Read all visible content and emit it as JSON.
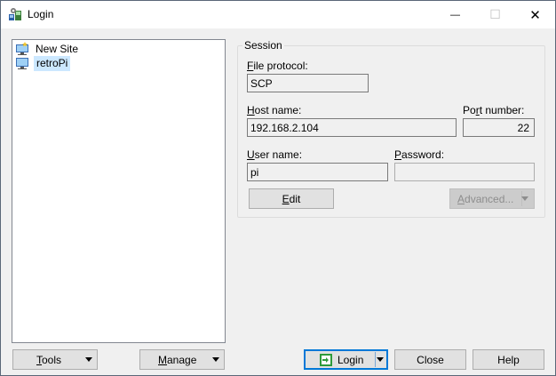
{
  "window": {
    "title": "Login",
    "minimize_glyph": "—",
    "maximize_glyph": "☐",
    "close_glyph": "✕"
  },
  "sites": [
    {
      "label": "New Site",
      "icon": "new-site-icon",
      "selected": false
    },
    {
      "label": "retroPi",
      "icon": "computer-icon",
      "selected": true
    }
  ],
  "session": {
    "group_label": "Session",
    "file_protocol_label": "File protocol:",
    "file_protocol_value": "SCP",
    "host_name_label": "Host name:",
    "host_name_value": "192.168.2.104",
    "port_number_label": "Port number:",
    "port_number_value": "22",
    "user_name_label": "User name:",
    "user_name_value": "pi",
    "password_label": "Password:",
    "password_value": "",
    "edit_button": "Edit",
    "advanced_button": "Advanced..."
  },
  "bottom": {
    "tools_button": "Tools",
    "manage_button": "Manage",
    "login_button": "Login",
    "close_button": "Close",
    "help_button": "Help"
  },
  "colors": {
    "selection": "#cce8ff",
    "focus_border": "#0078d7",
    "window_bg": "#f0f0f0"
  }
}
